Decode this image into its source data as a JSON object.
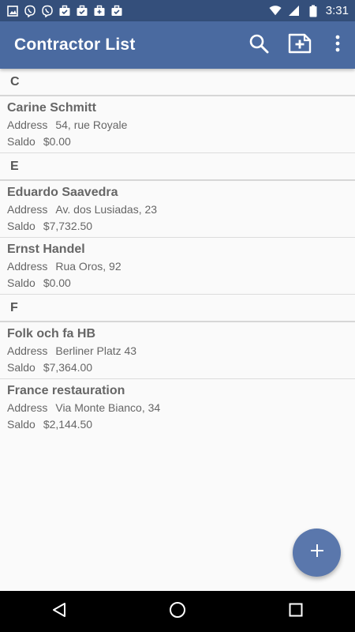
{
  "status_bar": {
    "time": "3:31",
    "left_icons": [
      "image-icon",
      "viber-icon",
      "viber-icon",
      "briefcase-check-icon",
      "briefcase-check-icon",
      "briefcase-plus-icon",
      "briefcase-check-icon"
    ],
    "right_icons": [
      "wifi-icon",
      "signal-icon",
      "battery-icon"
    ]
  },
  "app_bar": {
    "title": "Contractor List",
    "actions": [
      "search-icon",
      "add-document-icon",
      "more-vert-icon"
    ]
  },
  "sections": [
    {
      "letter": "C",
      "contacts": [
        {
          "name": "Carine Schmitt",
          "address_label": "Address",
          "address": "54, rue Royale",
          "saldo_label": "Saldo",
          "saldo": "$0.00"
        }
      ]
    },
    {
      "letter": "E",
      "contacts": [
        {
          "name": "Eduardo Saavedra",
          "address_label": "Address",
          "address": "Av. dos Lusiadas, 23",
          "saldo_label": "Saldo",
          "saldo": "$7,732.50"
        },
        {
          "name": "Ernst Handel",
          "address_label": "Address",
          "address": "Rua Oros, 92",
          "saldo_label": "Saldo",
          "saldo": "$0.00"
        }
      ]
    },
    {
      "letter": "F",
      "contacts": [
        {
          "name": "Folk och fa HB",
          "address_label": "Address",
          "address": "Berliner Platz 43",
          "saldo_label": "Saldo",
          "saldo": "$7,364.00"
        },
        {
          "name": "France restauration",
          "address_label": "Address",
          "address": "Via Monte Bianco, 34",
          "saldo_label": "Saldo",
          "saldo": "$2,144.50"
        }
      ]
    }
  ],
  "fab": {
    "icon": "plus-icon"
  },
  "nav_bar": {
    "buttons": [
      "back-icon",
      "home-icon",
      "recents-icon"
    ]
  },
  "colors": {
    "status_bar": "#344f7b",
    "app_bar": "#4a6aa0",
    "fab": "#5a77ac"
  }
}
